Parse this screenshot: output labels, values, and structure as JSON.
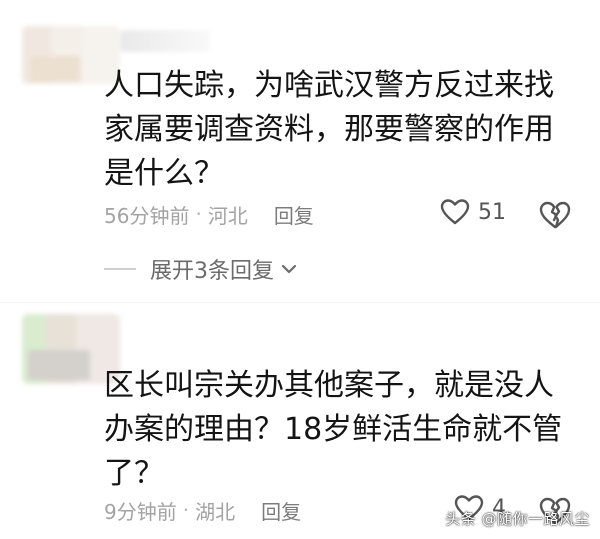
{
  "comments": [
    {
      "text": "人口失踪，为啥武汉警方反过来找家属要调查资料，那要警察的作用是什么？",
      "time": "56分钟前",
      "separator": "·",
      "location": "河北",
      "reply_label": "回复",
      "like_count": "51",
      "like_icon": "heart-outline-icon",
      "dislike_icon": "broken-heart-icon",
      "expand_label": "展开3条回复"
    },
    {
      "text": "区长叫宗关办其他案子，就是没人办案的理由？18岁鲜活生命就不管了？",
      "time": "9分钟前",
      "separator": "·",
      "location": "湖北",
      "reply_label": "回复",
      "like_count": "4",
      "like_icon": "heart-outline-icon",
      "dislike_icon": "broken-heart-icon"
    }
  ],
  "watermark": "头条 @随你一路风尘",
  "colors": {
    "meta_text": "#a3a3a3",
    "body_text": "#141414",
    "icon_stroke": "#555555"
  }
}
